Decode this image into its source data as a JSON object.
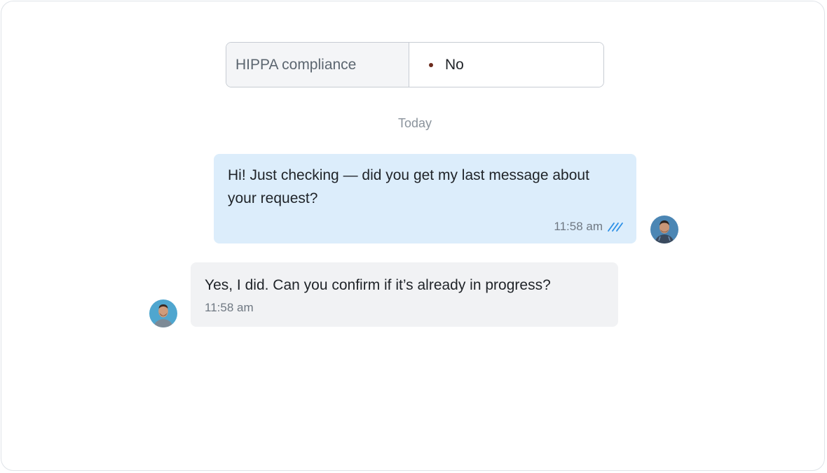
{
  "field": {
    "label": "HIPPA compliance",
    "value": "No",
    "dot_color": "#6b2a1c"
  },
  "date_divider": "Today",
  "messages": [
    {
      "direction": "outgoing",
      "text": "Hi! Just checking — did you get my last message about your request?",
      "time": "11:58 am",
      "status": "read",
      "status_icon": "double-check-icon"
    },
    {
      "direction": "incoming",
      "text": "Yes, I did. Can you confirm if it’s already in progress?",
      "time": "11:58 am"
    }
  ],
  "colors": {
    "outgoing_bubble": "#dcedfb",
    "incoming_bubble": "#f1f2f4",
    "read_check": "#2b8fe6"
  }
}
